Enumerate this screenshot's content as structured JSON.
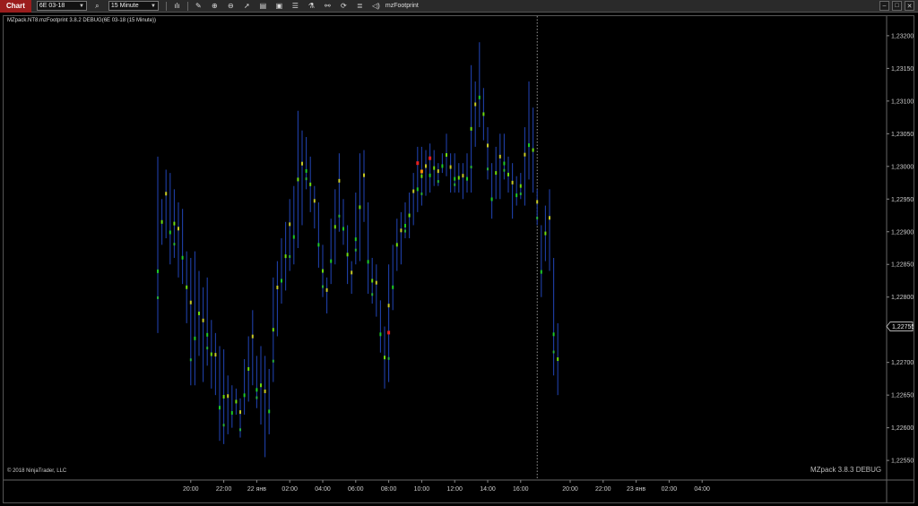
{
  "toolbar": {
    "tab_label": "Chart",
    "instrument": "6E 03-18",
    "interval": "15 Minute",
    "indicator_label": "mzFootprint"
  },
  "chart": {
    "label": "MZpack.NT8.mzFootprint 3.8.2 DEBUG(6E 03-18 (15 Minute))",
    "copyright": "© 2018 NinjaTrader, LLC",
    "watermark": "MZpack 3.8.3 DEBUG",
    "current_price_label": "1,22755",
    "current_price": 1.22755
  },
  "chart_data": {
    "type": "bar",
    "y_axis": {
      "range": [
        1.2252,
        1.2323
      ],
      "ticks": [
        "1,23200",
        "1,23150",
        "1,23100",
        "1,23050",
        "1,23000",
        "1,22950",
        "1,22900",
        "1,22850",
        "1,22800",
        "1,22700",
        "1,22650",
        "1,22600",
        "1,22550"
      ],
      "tick_values": [
        1.232,
        1.2315,
        1.231,
        1.2305,
        1.23,
        1.2295,
        1.229,
        1.2285,
        1.228,
        1.227,
        1.2265,
        1.226,
        1.2255
      ]
    },
    "x_axis": {
      "ticks": [
        "20:00",
        "22:00",
        "22 янв",
        "02:00",
        "04:00",
        "06:00",
        "08:00",
        "10:00",
        "12:00",
        "14:00",
        "16:00",
        "20:00",
        "22:00",
        "23 янв",
        "02:00",
        "04:00"
      ],
      "tick_index": [
        8,
        16,
        24,
        32,
        40,
        48,
        56,
        64,
        72,
        80,
        88,
        100,
        108,
        116,
        124,
        132
      ]
    },
    "session_break_index": 92,
    "bars": [
      [
        1.23015,
        1.22745
      ],
      [
        1.2295,
        1.2288
      ],
      [
        1.22995,
        1.2289
      ],
      [
        1.2299,
        1.2285
      ],
      [
        1.22965,
        1.2286
      ],
      [
        1.22945,
        1.2283
      ],
      [
        1.22935,
        1.2282
      ],
      [
        1.2287,
        1.2276
      ],
      [
        1.2286,
        1.22665
      ],
      [
        1.2287,
        1.22665
      ],
      [
        1.2284,
        1.2271
      ],
      [
        1.22815,
        1.2267
      ],
      [
        1.2283,
        1.22695
      ],
      [
        1.22765,
        1.2266
      ],
      [
        1.22745,
        1.2265
      ],
      [
        1.22725,
        1.2258
      ],
      [
        1.2272,
        1.22575
      ],
      [
        1.2268,
        1.2259
      ],
      [
        1.22665,
        1.226
      ],
      [
        1.2266,
        1.2262
      ],
      [
        1.22645,
        1.22585
      ],
      [
        1.22705,
        1.2262
      ],
      [
        1.2274,
        1.2264
      ],
      [
        1.2278,
        1.22665
      ],
      [
        1.2271,
        1.2263
      ],
      [
        1.22725,
        1.22605
      ],
      [
        1.2271,
        1.22555
      ],
      [
        1.2269,
        1.2259
      ],
      [
        1.2283,
        1.2267
      ],
      [
        1.22855,
        1.2274
      ],
      [
        1.2289,
        1.2279
      ],
      [
        1.22915,
        1.2281
      ],
      [
        1.2295,
        1.2284
      ],
      [
        1.2297,
        1.2285
      ],
      [
        1.23085,
        1.22875
      ],
      [
        1.23055,
        1.2291
      ],
      [
        1.23045,
        1.22965
      ],
      [
        1.23015,
        1.2293
      ],
      [
        1.2297,
        1.22905
      ],
      [
        1.22945,
        1.22845
      ],
      [
        1.2288,
        1.228
      ],
      [
        1.2283,
        1.22775
      ],
      [
        1.2292,
        1.2282
      ],
      [
        1.22965,
        1.2285
      ],
      [
        1.2302,
        1.229
      ],
      [
        1.2295,
        1.2288
      ],
      [
        1.2291,
        1.2282
      ],
      [
        1.22855,
        1.22805
      ],
      [
        1.2296,
        1.2285
      ],
      [
        1.2302,
        1.22855
      ],
      [
        1.23025,
        1.22915
      ],
      [
        1.22945,
        1.22805
      ],
      [
        1.2286,
        1.2279
      ],
      [
        1.2285,
        1.2277
      ],
      [
        1.22795,
        1.22715
      ],
      [
        1.22755,
        1.2266
      ],
      [
        1.2285,
        1.2267
      ],
      [
        1.2288,
        1.2278
      ],
      [
        1.2292,
        1.2284
      ],
      [
        1.2293,
        1.2285
      ],
      [
        1.22945,
        1.2289
      ],
      [
        1.2296,
        1.2289
      ],
      [
        1.2299,
        1.2291
      ],
      [
        1.2303,
        1.2293
      ],
      [
        1.2303,
        1.2294
      ],
      [
        1.23025,
        1.22955
      ],
      [
        1.23035,
        1.2296
      ],
      [
        1.23025,
        1.2297
      ],
      [
        1.23005,
        1.2297
      ],
      [
        1.2302,
        1.2299
      ],
      [
        1.2305,
        1.22985
      ],
      [
        1.2302,
        1.2296
      ],
      [
        1.2302,
        1.2296
      ],
      [
        1.23005,
        1.2296
      ],
      [
        1.23005,
        1.2295
      ],
      [
        1.2302,
        1.2296
      ],
      [
        1.23155,
        1.2296
      ],
      [
        1.2313,
        1.2303
      ],
      [
        1.2319,
        1.2306
      ],
      [
        1.2312,
        1.2304
      ],
      [
        1.2306,
        1.2298
      ],
      [
        1.23005,
        1.2292
      ],
      [
        1.2303,
        1.2295
      ],
      [
        1.2305,
        1.2295
      ],
      [
        1.2305,
        1.2298
      ],
      [
        1.23015,
        1.2296
      ],
      [
        1.23005,
        1.2292
      ],
      [
        1.22985,
        1.2294
      ],
      [
        1.2299,
        1.2295
      ],
      [
        1.2306,
        1.2294
      ],
      [
        1.2313,
        1.2298
      ],
      [
        1.2309,
        1.2296
      ],
      [
        1.22965,
        1.2291
      ],
      [
        1.2291,
        1.228
      ],
      [
        1.2294,
        1.22855
      ],
      [
        1.22965,
        1.2284
      ],
      [
        1.2286,
        1.2268
      ],
      [
        1.2276,
        1.2265
      ]
    ]
  }
}
